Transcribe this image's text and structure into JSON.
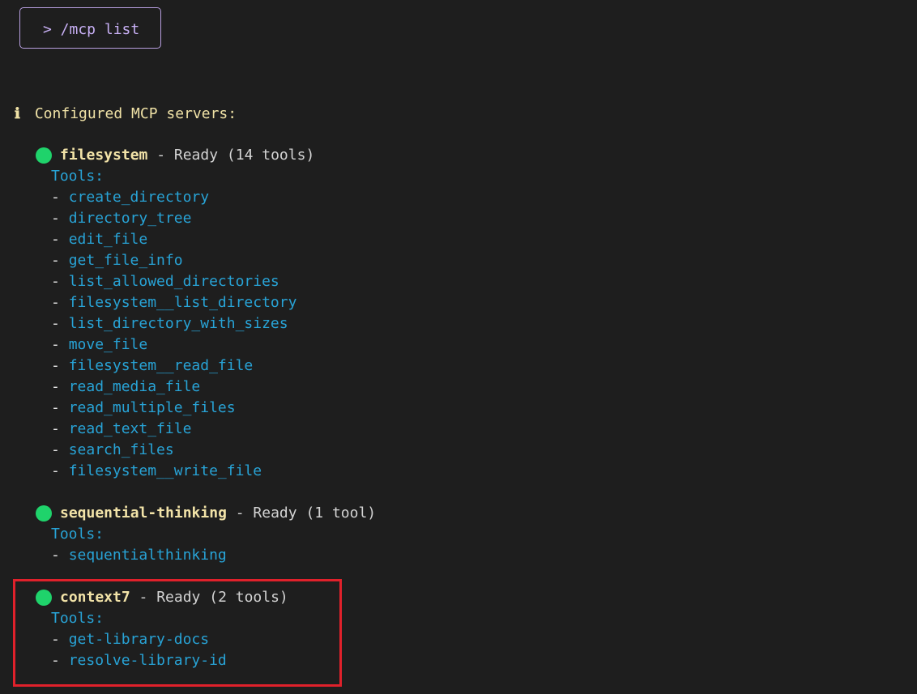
{
  "prompt": {
    "text": "> /mcp list"
  },
  "header": {
    "icon": "info-icon",
    "icon_glyph": "ℹ",
    "text": "Configured MCP servers:"
  },
  "colors": {
    "ready": "#1fd36b",
    "highlight": "#e0212b"
  },
  "servers": [
    {
      "name": "filesystem",
      "status": " - Ready (14 tools)",
      "tools_label": "Tools:",
      "tools": [
        "create_directory",
        "directory_tree",
        "edit_file",
        "get_file_info",
        "list_allowed_directories",
        "filesystem__list_directory",
        "list_directory_with_sizes",
        "move_file",
        "filesystem__read_file",
        "read_media_file",
        "read_multiple_files",
        "read_text_file",
        "search_files",
        "filesystem__write_file"
      ]
    },
    {
      "name": "sequential-thinking",
      "status": " - Ready (1 tool)",
      "tools_label": "Tools:",
      "tools": [
        "sequentialthinking"
      ]
    },
    {
      "name": "context7",
      "status": " - Ready (2 tools)",
      "tools_label": "Tools:",
      "tools": [
        "get-library-docs",
        "resolve-library-id"
      ]
    }
  ]
}
